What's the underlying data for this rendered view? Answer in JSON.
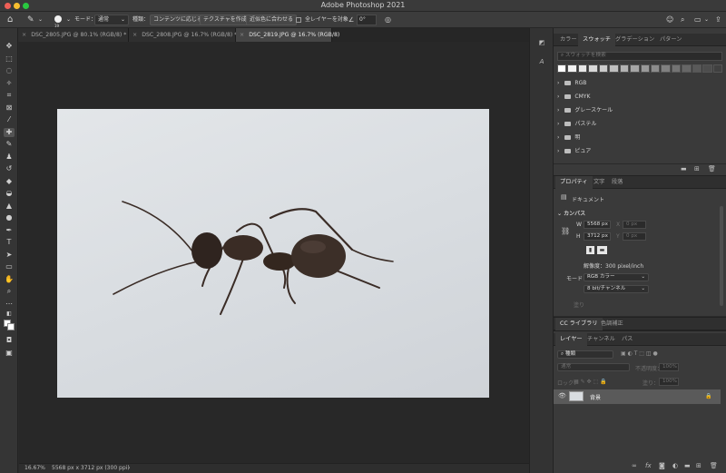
{
  "window": {
    "title": "Adobe Photoshop 2021"
  },
  "options_bar": {
    "brush_size": "19",
    "mode_label": "モード：",
    "mode_value": "通常",
    "type_label": "種類：",
    "type_options": [
      "コンテンツに応じる",
      "テクスチャを作成",
      "近似色に合わせる"
    ],
    "sample_all_layers": "全レイヤーを対象",
    "angle": "0°"
  },
  "doc_tabs": [
    {
      "label": "DSC_2805.JPG @ 80.1% (RGB/8) *",
      "active": false
    },
    {
      "label": "DSC_2808.JPG @ 16.7% (RGB/8) *",
      "active": false
    },
    {
      "label": "DSC_2819.JPG @ 16.7% (RGB/8)",
      "active": true
    }
  ],
  "status_bar": {
    "zoom": "16.67%",
    "info": "5568 px x 3712 px (300 ppi)",
    "arrow": "›"
  },
  "swatches_panel": {
    "tabs": [
      "カラー",
      "スウォッチ",
      "グラデーション",
      "パターン"
    ],
    "active_tab": "スウォッチ",
    "search_placeholder": "スウォッチを検索",
    "swatch_colors": [
      "#ffffff",
      "#f2f2f2",
      "#e6e6e6",
      "#d9d9d9",
      "#cccccc",
      "#bfbfbf",
      "#b3b3b3",
      "#a6a6a6",
      "#999999",
      "#8c8c8c",
      "#808080",
      "#737373",
      "#666666",
      "#595959",
      "#4d4d4d",
      "#404040"
    ],
    "groups": [
      "RGB",
      "CMYK",
      "グレースケール",
      "パステル",
      "明",
      "ピュア"
    ]
  },
  "properties_panel": {
    "tabs": [
      "プロパティ",
      "文字",
      "段落"
    ],
    "active_tab": "プロパティ",
    "doc_label": "ドキュメント",
    "section_canvas": "カンバス",
    "w_label": "W",
    "w_value": "5568 px",
    "x_label": "X",
    "x_value": "0 px",
    "h_label": "H",
    "h_value": "3712 px",
    "y_label": "Y",
    "y_value": "0 px",
    "resolution": "解像度：300 pixel/inch",
    "mode_label": "モード",
    "mode_value": "RGB カラー",
    "depth_value": "8 bit/チャンネル",
    "fill_label": "塗り"
  },
  "cc_panel": {
    "tabs": [
      "CC ライブラリ",
      "色調補正"
    ],
    "active_tab": "CC ライブラリ"
  },
  "layers_panel": {
    "tabs": [
      "レイヤー",
      "チャンネル",
      "パス"
    ],
    "active_tab": "レイヤー",
    "kind_placeholder": "種類",
    "blend_mode": "通常",
    "opacity_label": "不透明度：",
    "opacity_value": "100%",
    "lock_label": "ロック：",
    "fill_label": "塗り：",
    "fill_value": "100%",
    "layer_name": "背景"
  }
}
